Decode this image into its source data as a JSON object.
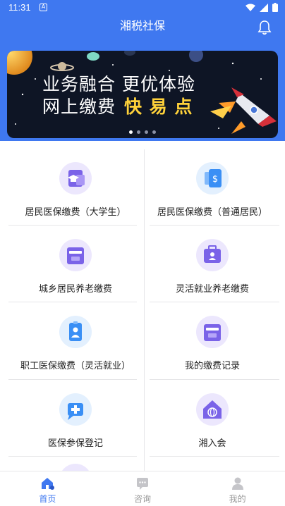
{
  "status_bar": {
    "time": "11:31",
    "a_badge": "A"
  },
  "header": {
    "title": "湘税社保"
  },
  "banner": {
    "line1": "业务融合 更优体验",
    "line2_prefix": "网上缴费",
    "line2_highlight": "快 易 点",
    "slide_count": 4,
    "active_slide": 1
  },
  "grid": [
    {
      "label": "居民医保缴费（大学生）",
      "icon": "graduation-card-icon"
    },
    {
      "label": "居民医保缴费（普通居民）",
      "icon": "dollar-card-icon"
    },
    {
      "label": "城乡居民养老缴费",
      "icon": "pension-box-icon"
    },
    {
      "label": "灵活就业养老缴费",
      "icon": "briefcase-person-icon"
    },
    {
      "label": "职工医保缴费（灵活就业）",
      "icon": "id-badge-icon"
    },
    {
      "label": "我的缴费记录",
      "icon": "record-box-icon"
    },
    {
      "label": "医保参保登记",
      "icon": "medical-plus-icon"
    },
    {
      "label": "湘入会",
      "icon": "home-globe-icon"
    }
  ],
  "bottom_nav": [
    {
      "label": "首页",
      "icon": "home-icon",
      "active": true
    },
    {
      "label": "咨询",
      "icon": "chat-icon",
      "active": false
    },
    {
      "label": "我的",
      "icon": "user-icon",
      "active": false
    }
  ],
  "colors": {
    "primary": "#3f78f0",
    "icon_purple": "#7a63e8",
    "icon_blue": "#3a8ff5"
  }
}
